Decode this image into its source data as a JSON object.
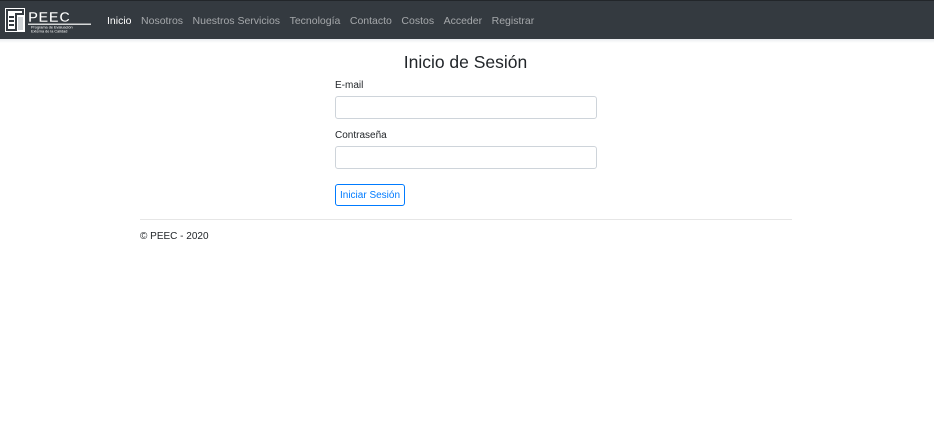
{
  "brand": {
    "logo_text": "PEEC",
    "logo_subtitle_line1": "Programa de Evaluación",
    "logo_subtitle_line2": "Externa de la Calidad"
  },
  "nav": {
    "items": [
      {
        "label": "Inicio",
        "active": true
      },
      {
        "label": "Nosotros",
        "active": false
      },
      {
        "label": "Nuestros Servicios",
        "active": false
      },
      {
        "label": "Tecnología",
        "active": false
      },
      {
        "label": "Contacto",
        "active": false
      },
      {
        "label": "Costos",
        "active": false
      },
      {
        "label": "Acceder",
        "active": false
      },
      {
        "label": "Registrar",
        "active": false
      }
    ]
  },
  "login": {
    "title": "Inicio de Sesión",
    "email_label": "E-mail",
    "email_value": "",
    "password_label": "Contraseña",
    "password_value": "",
    "submit_label": "Iniciar Sesión"
  },
  "footer": {
    "text": "© PEEC - 2020"
  },
  "colors": {
    "navbar_bg": "#343a40",
    "nav_link": "rgba(255,255,255,0.55)",
    "nav_link_active": "#ffffff",
    "primary": "#007bff",
    "input_border": "#ced4da"
  }
}
